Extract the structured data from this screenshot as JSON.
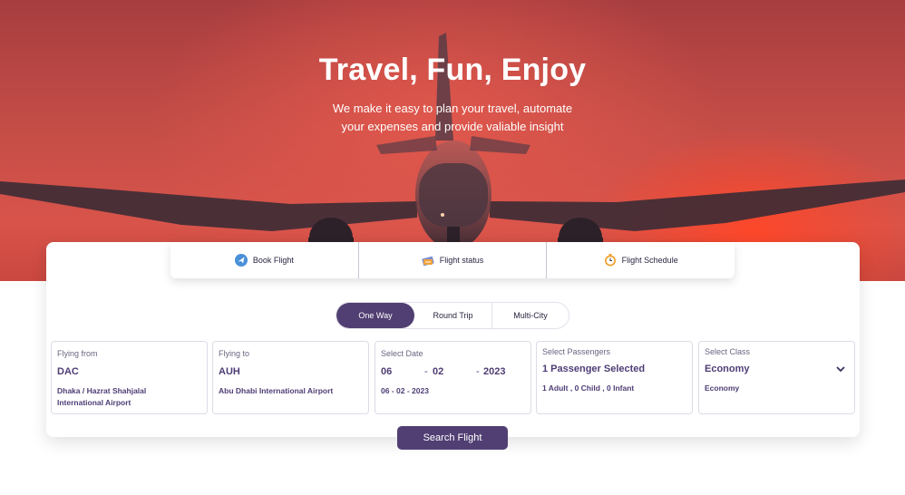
{
  "hero": {
    "title": "Travel, Fun, Enjoy",
    "subtitle_line1": "We make it easy to plan your travel, automate",
    "subtitle_line2": "your expenses and provide valiable insight"
  },
  "service_tabs": [
    {
      "label": "Book Flight",
      "icon": "airplane-icon"
    },
    {
      "label": "Flight status",
      "icon": "boarding-pass-icon"
    },
    {
      "label": "Flight Schedule",
      "icon": "clock-icon"
    }
  ],
  "trip_types": {
    "options": [
      "One Way",
      "Round Trip",
      "Multi-City"
    ],
    "selected": "One Way"
  },
  "search_form": {
    "from": {
      "label": "Flying from",
      "code": "DAC",
      "airport_line1": "Dhaka / Hazrat Shahjalal",
      "airport_line2": "International Airport"
    },
    "to": {
      "label": "Flying to",
      "code": "AUH",
      "airport": "Abu Dhabi International Airport"
    },
    "date": {
      "label": "Select Date",
      "day": "06",
      "month": "02",
      "year": "2023",
      "full": "06 - 02 - 2023"
    },
    "passengers": {
      "label": "Select Passengers",
      "value": "1 Passenger Selected",
      "detail": "1 Adult , 0 Child , 0 Infant"
    },
    "class": {
      "label": "Select Class",
      "value": "Economy",
      "detail": "Economy"
    }
  },
  "search_button": "Search Flight",
  "colors": {
    "accent": "#513f73",
    "text_accent": "#4e3d75",
    "hero": "#c44d47"
  }
}
